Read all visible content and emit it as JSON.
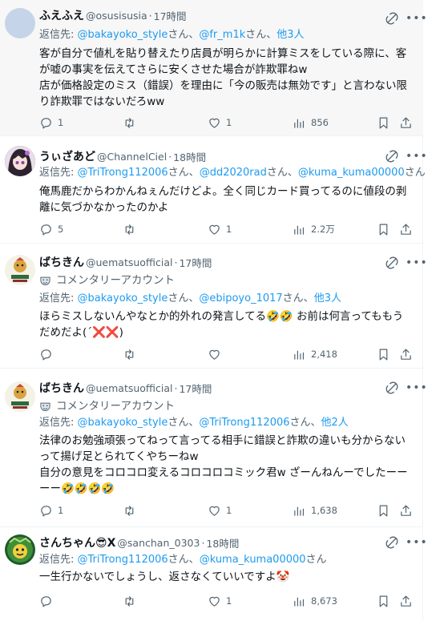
{
  "tweets": [
    {
      "display_name": "ふえふえ",
      "handle": "@osusisusia",
      "sep": "·",
      "time": "17時間",
      "reply_prefix": "返信先: ",
      "reply_mentions": [
        "@bakayoko_style",
        "@fr_m1k",
        "他3人"
      ],
      "reply_joiners": [
        "さん、",
        "さん、",
        ""
      ],
      "lines": [
        "客が自分で値札を貼り替えたり店員が明らかに計算ミスをしている際に、客",
        "が嘘の事実を伝えてさらに安くさせた場合が詐欺罪ねw",
        "店が価格設定のミス（錯誤）を理由に「今の販売は無効です」と言わない限",
        "り詐欺罪ではないだろww"
      ],
      "replies": "1",
      "retweets": "",
      "likes": "1",
      "views": "856"
    },
    {
      "display_name": "うぃざあど",
      "handle": "@ChannelCiel",
      "sep": "·",
      "time": "18時間",
      "reply_prefix": "返信先: ",
      "reply_mentions": [
        "@TriTrong112006",
        "@dd2020rad",
        "@kuma_kuma00000"
      ],
      "reply_joiners": [
        "さん、",
        "さん、",
        "さん"
      ],
      "lines": [
        "俺馬鹿だからわかんねぇんだけどよ。全く同じカード買ってるのに値段の剥",
        "離に気づかなかったのかよ"
      ],
      "replies": "5",
      "retweets": "",
      "likes": "1",
      "views": "2.2万"
    },
    {
      "display_name": "ばちきん",
      "handle": "@uematsuofficial",
      "sep": "·",
      "time": "17時間",
      "commentary": "コメンタリーアカウント",
      "reply_prefix": "返信先: ",
      "reply_mentions": [
        "@bakayoko_style",
        "@ebipoyo_1017",
        "他3人"
      ],
      "reply_joiners": [
        "さん、",
        "さん、",
        ""
      ],
      "lines": [
        "ほらミスしないんやなとか的外れの発言してる🤣🤣 お前は何言ってももう",
        "だめだよ(´❌❌)"
      ],
      "replies": "",
      "retweets": "",
      "likes": "",
      "views": "2,418"
    },
    {
      "display_name": "ばちきん",
      "handle": "@uematsuofficial",
      "sep": "·",
      "time": "17時間",
      "commentary": "コメンタリーアカウント",
      "reply_prefix": "返信先: ",
      "reply_mentions": [
        "@bakayoko_style",
        "@TriTrong112006",
        "他2人"
      ],
      "reply_joiners": [
        "さん、",
        "さん、",
        ""
      ],
      "lines": [
        "法律のお勉強頑張ってねって言ってる相手に錯誤と詐欺の違いも分からない",
        "って揚げ足とられてくやちーねw",
        "自分の意見をコロコロ変えるコロコロコミック君w ざーんねんーでしたーー",
        "ーー🤣🤣🤣🤣"
      ],
      "replies": "1",
      "retweets": "",
      "likes": "1",
      "views": "1,638"
    },
    {
      "display_name": "さんちゃん😎X",
      "handle": "@sanchan_0303",
      "sep": "·",
      "time": "18時間",
      "reply_prefix": "返信先: ",
      "reply_mentions": [
        "@TriTrong112006",
        "@kuma_kuma00000"
      ],
      "reply_joiners": [
        "さん、",
        "さん"
      ],
      "lines": [
        "一生行かないでしょうし、返さなくていいですよ🤡"
      ],
      "replies": "",
      "retweets": "",
      "likes": "1",
      "views": "8,673"
    }
  ],
  "colors": {
    "link": "#1d9bf0",
    "muted": "#536471",
    "text": "#0f1419",
    "highlight_bg": "#f7f7f7"
  },
  "icons": {
    "reply": "reply-icon",
    "retweet": "retweet-icon",
    "like": "heart-icon",
    "views": "views-icon",
    "bookmark": "bookmark-icon",
    "share": "share-icon",
    "grok": "grok-icon",
    "more": "more-icon"
  }
}
